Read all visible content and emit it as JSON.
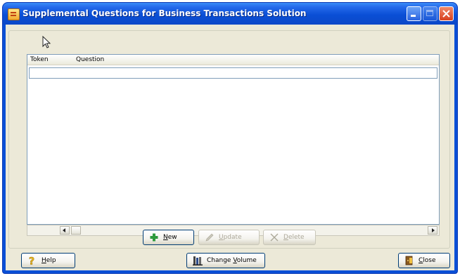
{
  "window": {
    "title": "Supplemental Questions for Business Transactions Solution"
  },
  "list": {
    "columns": [
      {
        "label": "Token"
      },
      {
        "label": "Question"
      }
    ],
    "rows": []
  },
  "actions": {
    "new": {
      "label": "New",
      "mnemonic": "N",
      "rest": "ew",
      "enabled": true
    },
    "update": {
      "label": "Update",
      "mnemonic": "U",
      "rest": "pdate",
      "enabled": false
    },
    "delete": {
      "label": "Delete",
      "mnemonic": "D",
      "rest": "elete",
      "enabled": false
    }
  },
  "footer": {
    "help": {
      "mnemonic": "H",
      "rest": "elp"
    },
    "change_volume": {
      "prefix": "Change ",
      "mnemonic": "V",
      "rest": "olume"
    },
    "close": {
      "mnemonic": "C",
      "rest": "lose"
    }
  },
  "colors": {
    "title_bar": "#0a4fd6",
    "dialog_face": "#ece9d8",
    "list_border": "#7f9db9",
    "disabled_text": "#aca899",
    "new_icon": "#2e9a3c",
    "close_button": "#d7401e"
  },
  "icons": {
    "app": "app-form-icon",
    "new": "plus-icon",
    "update": "pencil-icon",
    "delete": "x-icon",
    "help": "question-mark-icon",
    "change_volume": "books-icon",
    "close": "exit-door-icon"
  }
}
